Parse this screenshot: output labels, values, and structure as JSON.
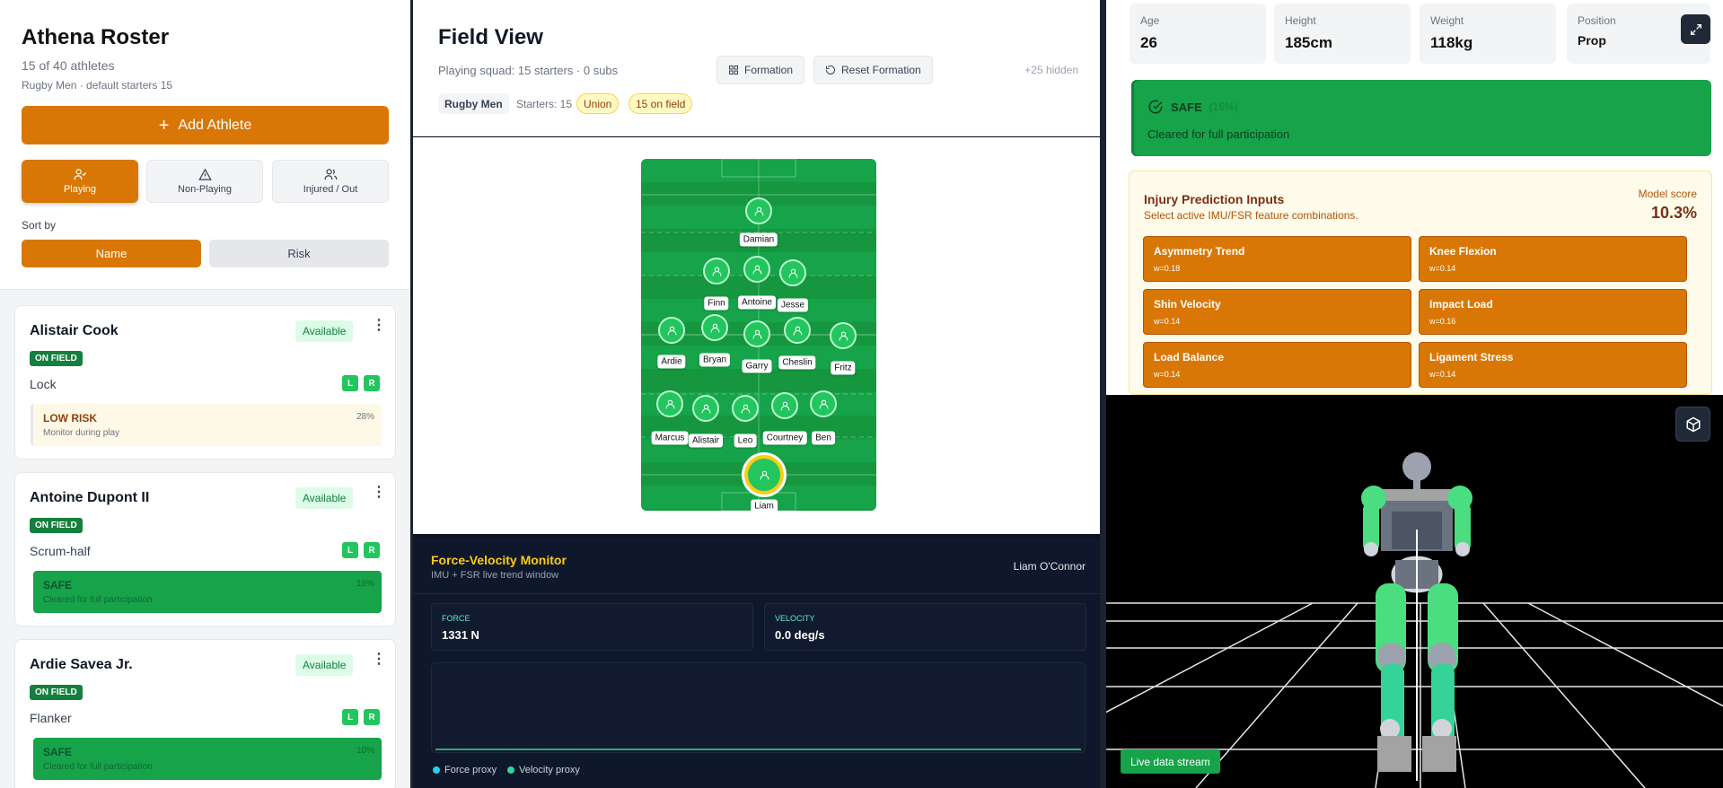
{
  "roster": {
    "title": "Athena Roster",
    "count": "15 of 40 athletes",
    "team_line": "Rugby Men · default starters 15",
    "add_label": "Add Athlete",
    "filters": [
      "Playing",
      "Non-Playing",
      "Injured / Out"
    ],
    "sort_label": "Sort by",
    "sort_options": [
      "Name",
      "Risk"
    ]
  },
  "athletes": [
    {
      "name": "Alistair Cook",
      "status": "Available",
      "field": "ON FIELD",
      "position": "Lock",
      "left": "L",
      "right": "R",
      "risk_label": "LOW RISK",
      "risk_desc": "Monitor during play",
      "risk_pct": "28%"
    },
    {
      "name": "Antoine Dupont II",
      "status": "Available",
      "field": "ON FIELD",
      "position": "Scrum-half",
      "left": "L",
      "right": "R",
      "risk_label": "SAFE",
      "risk_desc": "Cleared for full participation",
      "risk_pct": "19%"
    },
    {
      "name": "Ardie Savea Jr.",
      "status": "Available",
      "field": "ON FIELD",
      "position": "Flanker",
      "left": "L",
      "right": "R",
      "risk_label": "SAFE",
      "risk_desc": "Cleared for full participation",
      "risk_pct": "10%"
    }
  ],
  "field_view": {
    "title": "Field View",
    "squad": "Playing squad: 15 starters · 0 subs",
    "formation_btn": "Formation",
    "reset_btn": "Reset Formation",
    "hidden_count": "+25 hidden",
    "chip_team": "Rugby Men",
    "chip_starters": "Starters: 15",
    "chip_union": "Union",
    "chip_on_field": "15 on field",
    "players": [
      "Damian",
      "Finn",
      "Antoine",
      "Jesse",
      "Ardie",
      "Bryan",
      "Garry",
      "Cheslin",
      "Fritz",
      "Marcus",
      "Alistair",
      "Leo",
      "Courtney",
      "Ben",
      "Liam"
    ],
    "selected_player": "Liam"
  },
  "monitor": {
    "title": "Force-Velocity Monitor",
    "subtitle": "IMU + FSR live trend window",
    "athlete": "Liam O'Connor",
    "force_label": "FORCE",
    "force_value": "1331 N",
    "velocity_label": "VELOCITY",
    "velocity_value": "0.0 deg/s",
    "legend_force": "Force proxy",
    "legend_velocity": "Velocity proxy",
    "force_color": "#22d3ee",
    "velocity_color": "#34d399"
  },
  "profile": {
    "stats": [
      {
        "label": "Age",
        "value": "26"
      },
      {
        "label": "Height",
        "value": "185cm"
      },
      {
        "label": "Weight",
        "value": "118kg"
      },
      {
        "label": "Position",
        "value": "Prop"
      }
    ],
    "status_label": "SAFE",
    "status_pct": "(16%)",
    "status_desc": "Cleared for full participation"
  },
  "injury": {
    "title": "Injury Prediction Inputs",
    "subtitle": "Select active IMU/FSR feature combinations.",
    "score_label": "Model score",
    "score_value": "10.3%",
    "features": [
      {
        "name": "Asymmetry Trend",
        "weight": "w=0.18"
      },
      {
        "name": "Knee Flexion",
        "weight": "w=0.14"
      },
      {
        "name": "Shin Velocity",
        "weight": "w=0.14"
      },
      {
        "name": "Impact Load",
        "weight": "w=0.16"
      },
      {
        "name": "Load Balance",
        "weight": "w=0.14"
      },
      {
        "name": "Ligament Stress",
        "weight": "w=0.14"
      }
    ]
  },
  "viewer": {
    "live_label": "Live data stream"
  }
}
